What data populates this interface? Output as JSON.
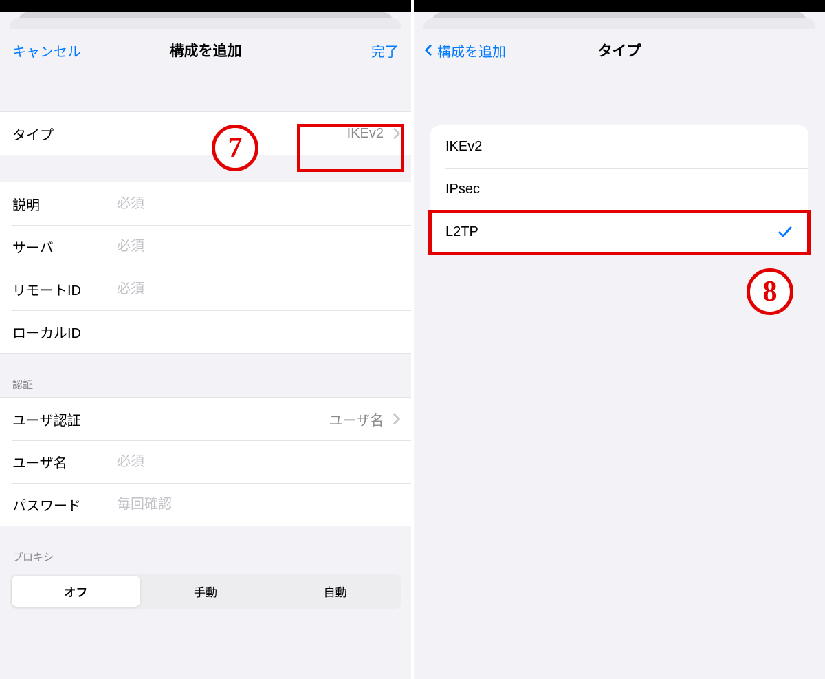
{
  "left": {
    "nav": {
      "cancel": "キャンセル",
      "title": "構成を追加",
      "done": "完了"
    },
    "type_row": {
      "label": "タイプ",
      "value": "IKEv2"
    },
    "fields": {
      "description_label": "説明",
      "description_placeholder": "必須",
      "server_label": "サーバ",
      "server_placeholder": "必須",
      "remote_id_label": "リモートID",
      "remote_id_placeholder": "必須",
      "local_id_label": "ローカルID"
    },
    "auth": {
      "header": "認証",
      "user_auth_label": "ユーザ認証",
      "user_auth_value": "ユーザ名",
      "username_label": "ユーザ名",
      "username_placeholder": "必須",
      "password_label": "パスワード",
      "password_placeholder": "毎回確認"
    },
    "proxy": {
      "header": "プロキシ",
      "segments": {
        "off": "オフ",
        "manual": "手動",
        "auto": "自動"
      }
    }
  },
  "right": {
    "nav": {
      "back": "構成を追加",
      "title": "タイプ"
    },
    "options": {
      "ikev2": "IKEv2",
      "ipsec": "IPsec",
      "l2tp": "L2TP"
    }
  },
  "annotations": {
    "seven": "7",
    "eight": "8"
  }
}
